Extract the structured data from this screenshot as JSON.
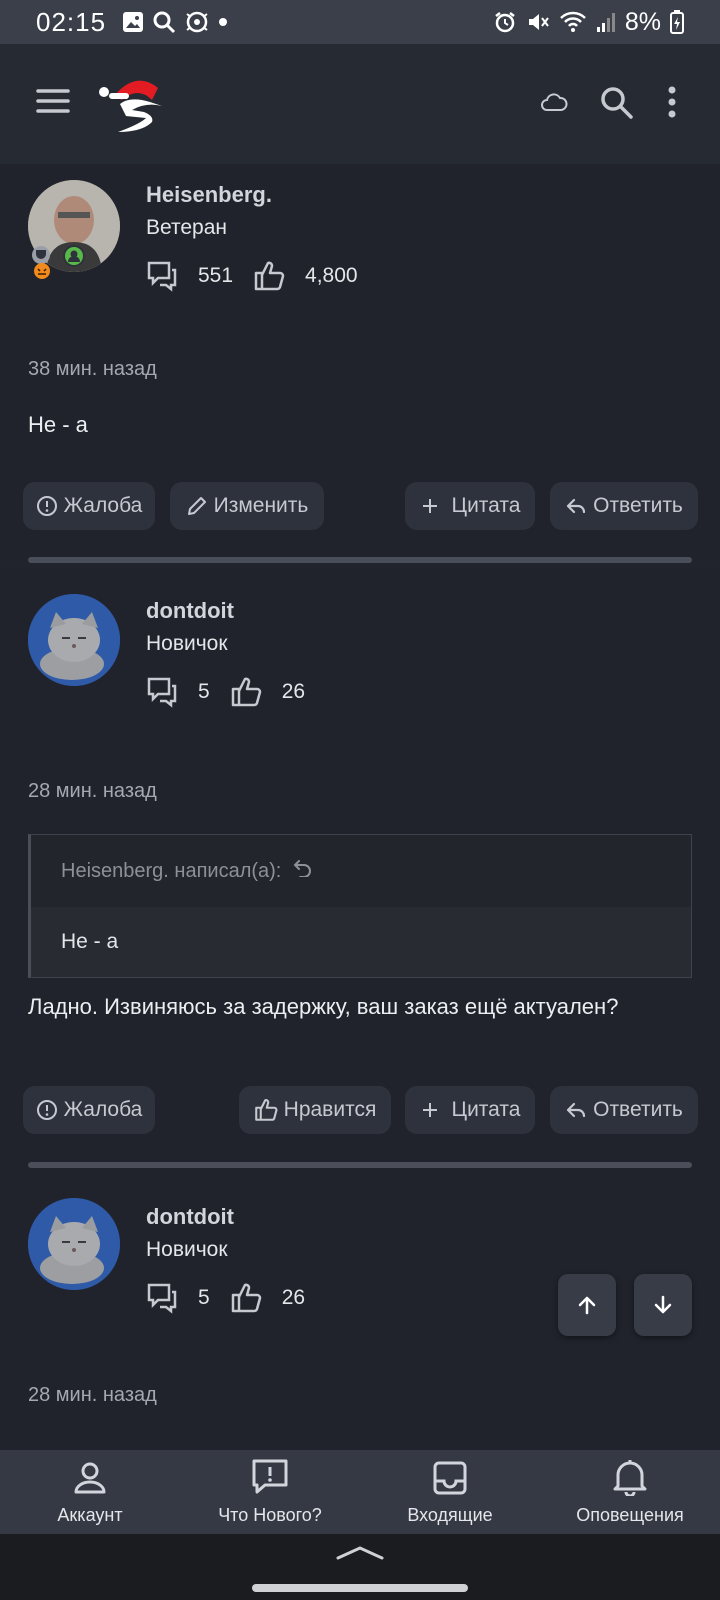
{
  "status_bar": {
    "time": "02:15",
    "battery": "8%"
  },
  "posts": [
    {
      "username": "Heisenberg.",
      "rank": "Ветеран",
      "messages": "551",
      "likes": "4,800",
      "time": "38 мин. назад",
      "text": "Не - а",
      "actions": {
        "report": "Жалоба",
        "edit": "Изменить",
        "quote": "Цитата",
        "reply": "Ответить"
      }
    },
    {
      "username": "dontdoit",
      "rank": "Новичок",
      "messages": "5",
      "likes": "26",
      "time": "28 мин. назад",
      "quote_header": "Heisenberg. написал(а):",
      "quote_text": "Не - а",
      "text": "Ладно. Извиняюсь за задержку, ваш заказ ещё актуален?",
      "actions": {
        "report": "Жалоба",
        "like": "Нравится",
        "quote": "Цитата",
        "reply": "Ответить"
      }
    },
    {
      "username": "dontdoit",
      "rank": "Новичок",
      "messages": "5",
      "likes": "26",
      "time": "28 мин. назад"
    }
  ],
  "bottom_nav": [
    {
      "label": "Аккаунт",
      "icon": "account-icon"
    },
    {
      "label": "Что Нового?",
      "icon": "whats-new-icon"
    },
    {
      "label": "Входящие",
      "icon": "inbox-icon"
    },
    {
      "label": "Оповещения",
      "icon": "bell-icon"
    }
  ],
  "colors": {
    "background": "#21242c",
    "app_bar": "#262a33",
    "button": "#2e323c",
    "bottom_nav": "#353944"
  }
}
